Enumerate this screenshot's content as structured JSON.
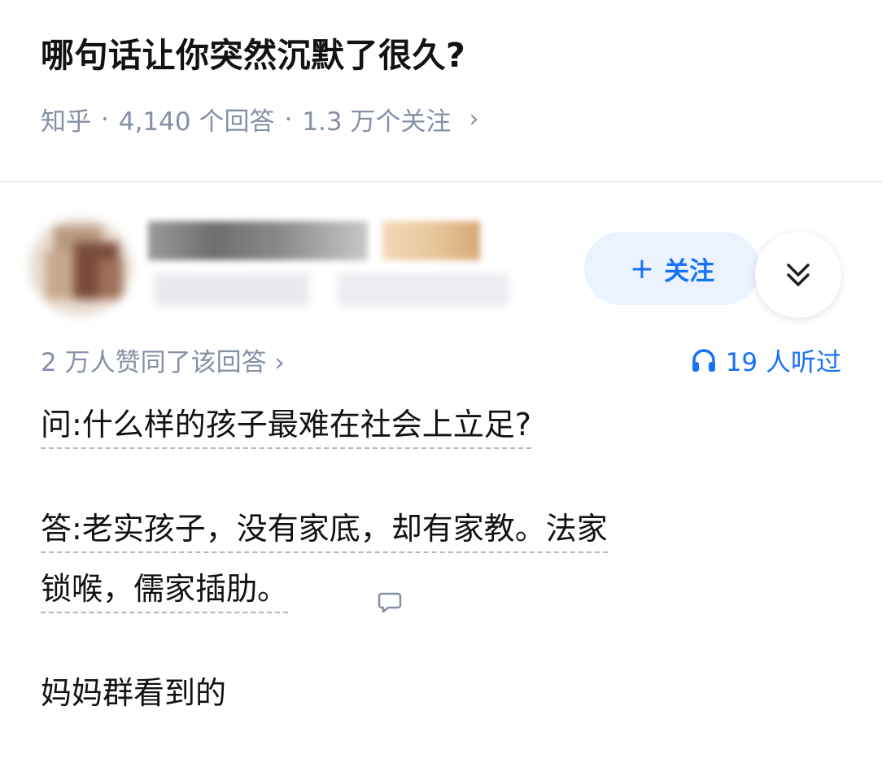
{
  "question": {
    "title": "哪句话让你突然沉默了很久?",
    "source": "知乎",
    "answers": "4,140 个回答",
    "followers": "1.3 万个关注",
    "chevron": "›"
  },
  "author": {
    "follow_label": "关注",
    "follow_icon": "plus-icon",
    "more_icon": "double-chevron-down-icon"
  },
  "answer": {
    "agree_text": "2 万人赞同了该回答 ›",
    "listen_count": "19 人听过",
    "listen_icon": "headphones-icon",
    "q_line": "问:什么样的孩子最难在社会上立足?",
    "a_line1": "答:老实孩子，没有家底，却有家教。法家",
    "a_line2": "锁喉，儒家插肋。",
    "tail": "妈妈群看到的"
  },
  "colors": {
    "accent": "#1772f6",
    "meta_gray": "#8590a6",
    "follow_bg": "#ebf3ff"
  }
}
